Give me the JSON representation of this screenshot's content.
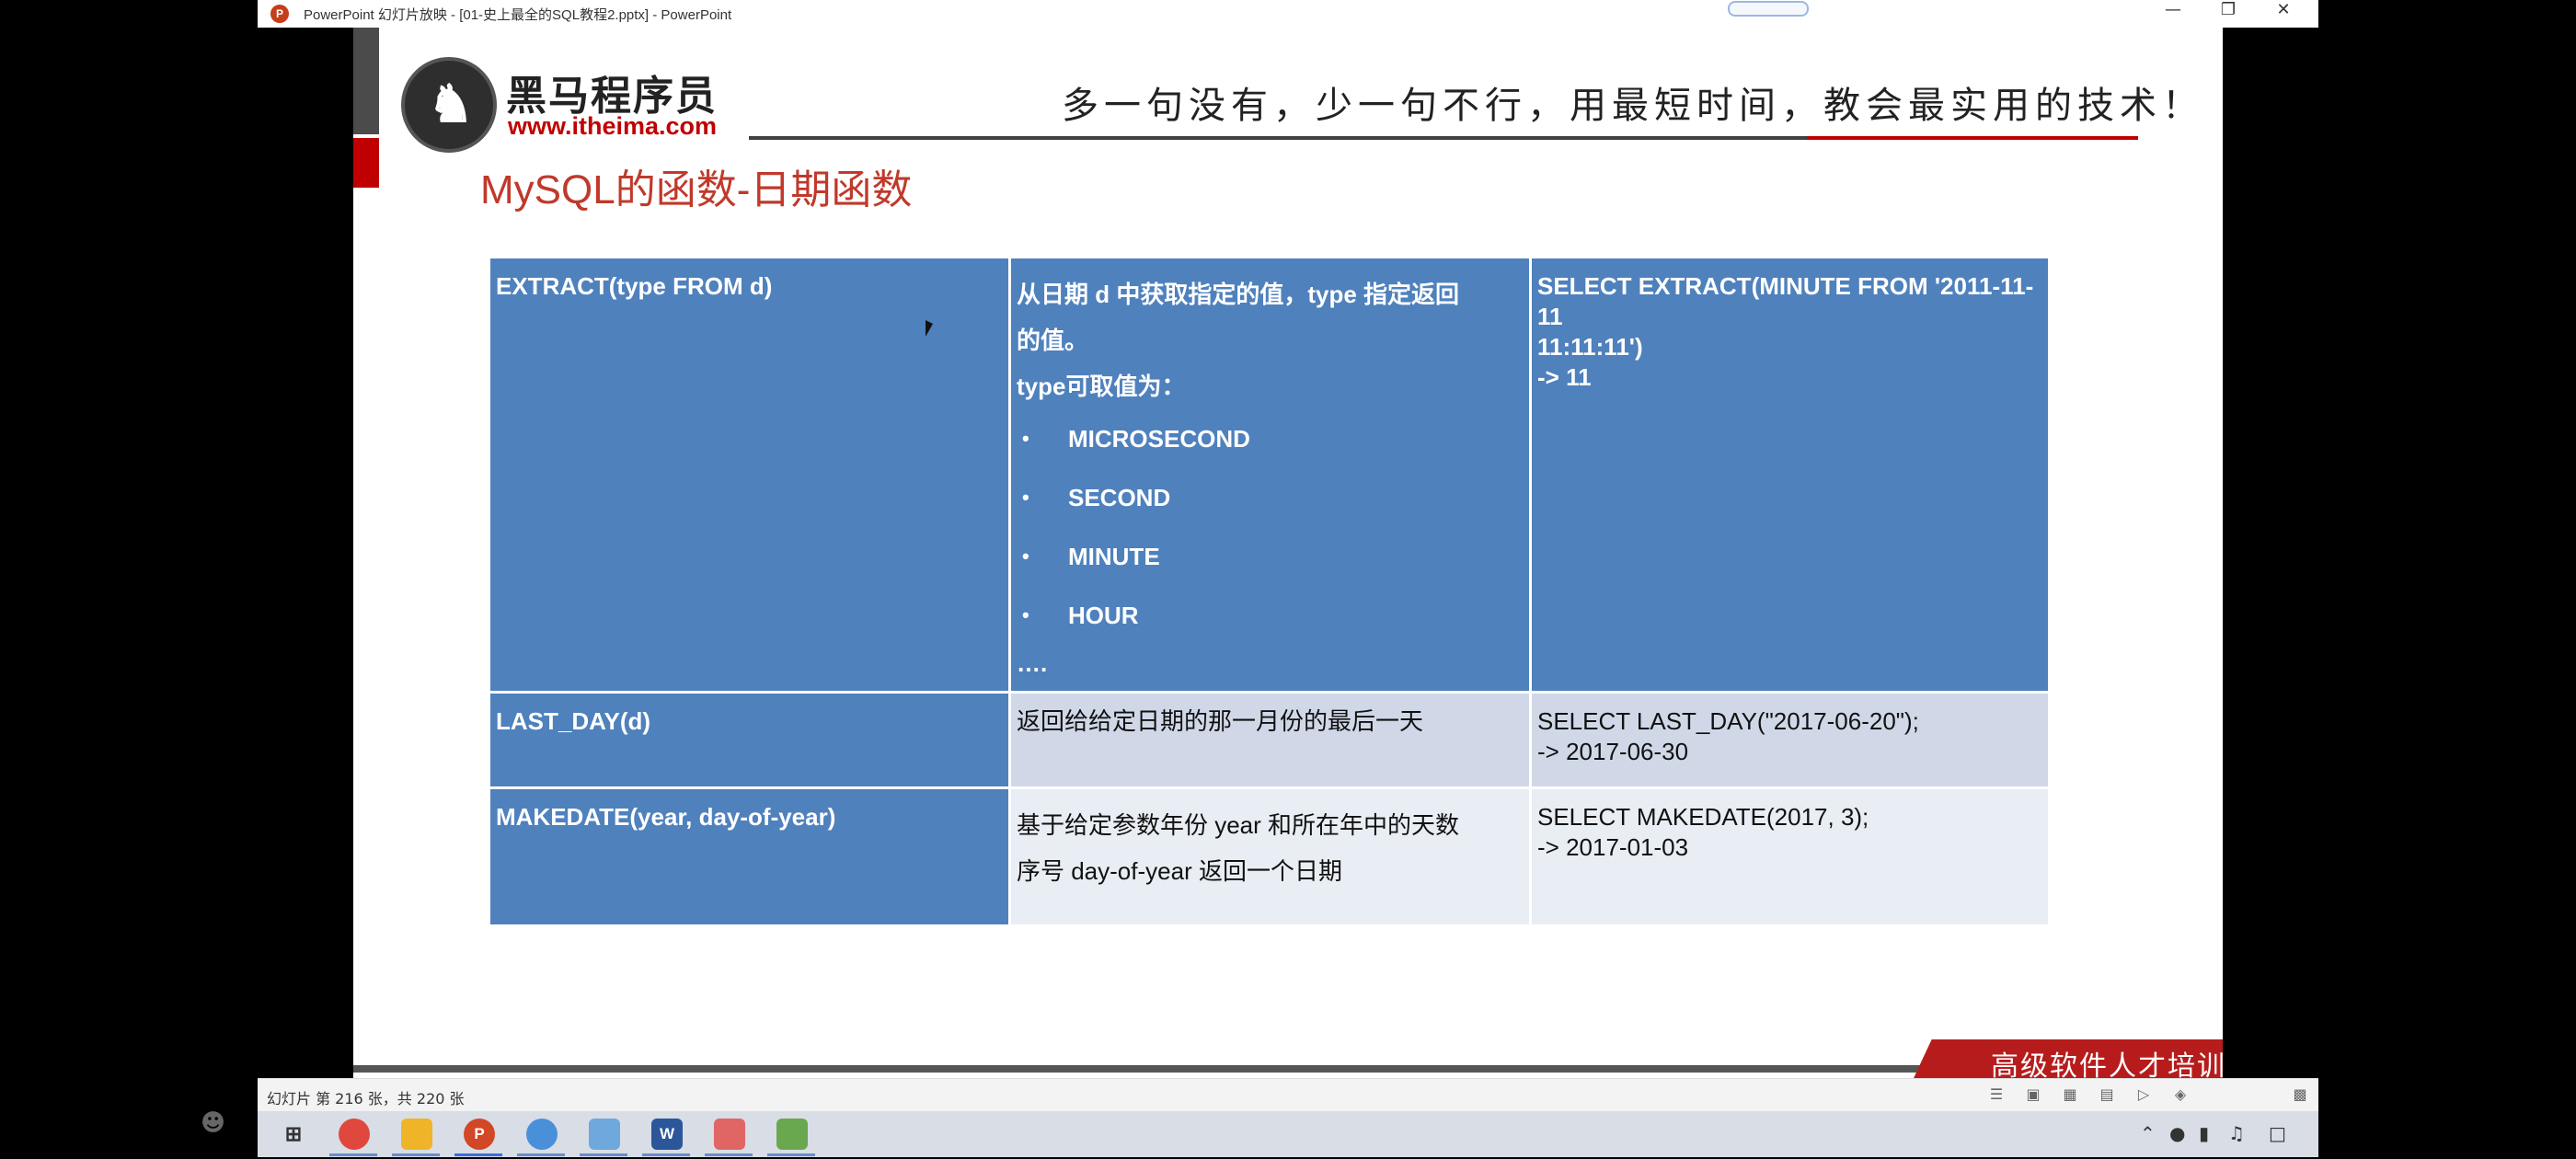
{
  "window": {
    "app_icon": "powerpoint-icon",
    "title": "PowerPoint 幻灯片放映 - [01-史上最全的SQL教程2.pptx] - PowerPoint",
    "minimize_icon": "minimize-icon",
    "restore_icon": "restore-icon",
    "close_icon": "close-icon"
  },
  "slide": {
    "logo_text": "黑马程序员",
    "logo_url": "www.itheima.com",
    "slogan": "多一句没有，少一句不行，用最短时间，教会最实用的技术！",
    "title": "MySQL的函数-日期函数",
    "banner": "高级软件人才培训专家",
    "table": {
      "rows": [
        {
          "name": "EXTRACT(type FROM d)",
          "desc": [
            "从日期 d 中获取指定的值，type 指定返回",
            "的值。"
          ],
          "type_label": "type可取值为：",
          "options": [
            "MICROSECOND",
            "SECOND",
            "MINUTE",
            "HOUR"
          ],
          "ellipsis": "….",
          "example": [
            "SELECT EXTRACT(MINUTE FROM '2011-11-11",
            "11:11:11')",
            "-> 11"
          ]
        },
        {
          "name": "LAST_DAY(d)",
          "desc": [
            "返回给给定日期的那一月份的最后一天"
          ],
          "example": [
            "SELECT LAST_DAY(\"2017-06-20\");",
            "-> 2017-06-30"
          ]
        },
        {
          "name": "MAKEDATE(year, day-of-year)",
          "desc": [
            "基于给定参数年份 year 和所在年中的天数",
            "序号 day-of-year 返回一个日期"
          ],
          "example": [
            "SELECT MAKEDATE(2017, 3);",
            "-> 2017-01-03"
          ]
        }
      ]
    }
  },
  "statusbar": {
    "slide_count": "幻灯片 第 216 张，共 220 张"
  },
  "taskbar": {
    "items": [
      "windows-start-icon",
      "chrome-icon",
      "file-explorer-icon",
      "powerpoint-icon",
      "browser-icon",
      "app-icon",
      "word-icon",
      "editor-icon",
      "chart-app-icon"
    ],
    "ppt_letter": "P",
    "word_letter": "W"
  }
}
